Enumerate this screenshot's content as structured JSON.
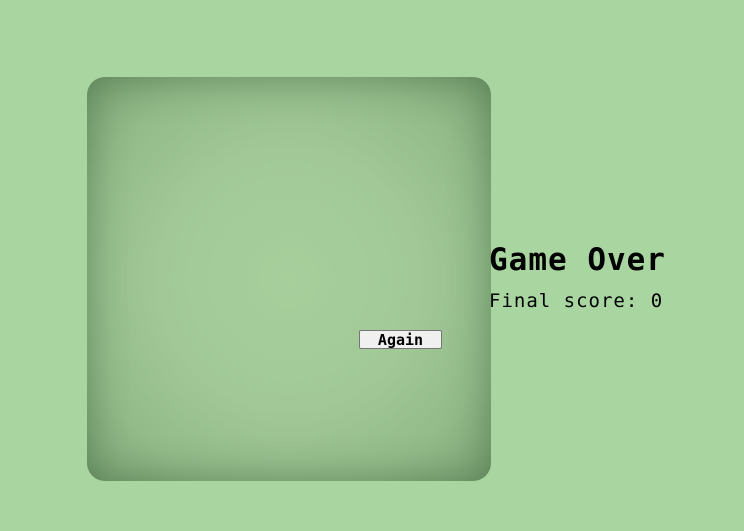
{
  "game": {
    "again_label": "Again",
    "title": "Game Over",
    "score_label": "Final score:",
    "score_value": "0"
  },
  "colors": {
    "background": "#a8d5a0",
    "screen": "#a2c898",
    "text": "#000000"
  }
}
